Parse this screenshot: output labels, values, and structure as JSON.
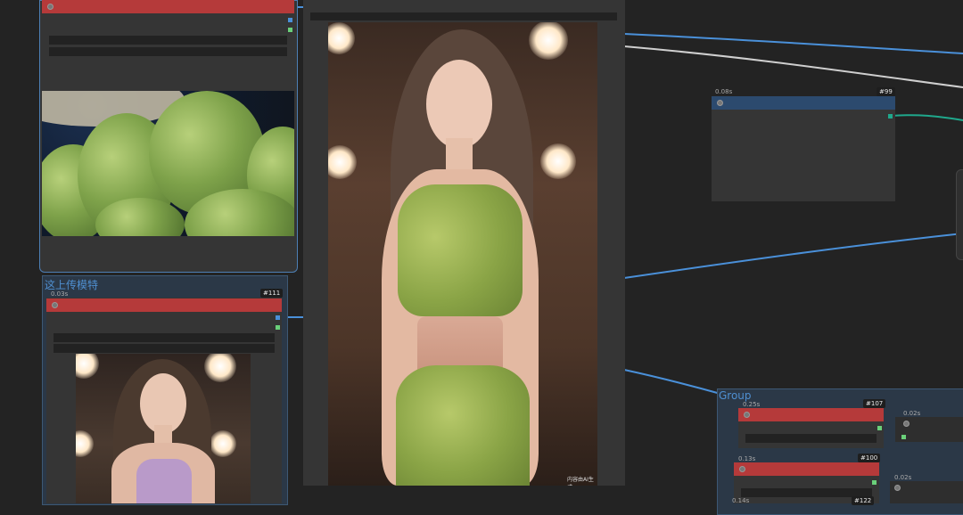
{
  "groups": {
    "upload_model_title": "这上传模特",
    "group_title": "Group"
  },
  "nodes": {
    "top_left": {},
    "upload": {
      "time": "0.03s",
      "id": "#111"
    },
    "preview": {
      "watermark": "内容由AI生成"
    },
    "n99": {
      "time": "0.08s",
      "id": "#99"
    },
    "n107": {
      "time": "0.25s",
      "id": "#107"
    },
    "n100": {
      "time": "0.13s",
      "id": "#100"
    },
    "n_right_a": {
      "time": "0.02s"
    },
    "n_right_b": {
      "time": "0.02s"
    },
    "n_bottom": {
      "time": "0.14s",
      "id": "#122"
    }
  },
  "colors": {
    "canvas": "#232323",
    "node_body": "#353535",
    "bar_error": "#b53a3a",
    "bar_blue": "#2c4a6e",
    "wire_blue": "#4a90d9",
    "wire_white": "#cfcfcf",
    "wire_teal": "#1fa88c",
    "group_label": "#4f8fd0"
  }
}
